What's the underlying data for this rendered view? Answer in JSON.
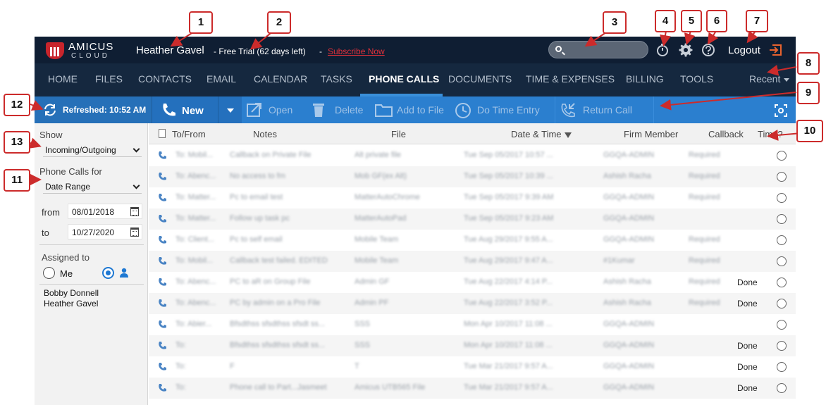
{
  "header": {
    "logo_text": "AMICUS",
    "logo_sub": "CLOUD",
    "user_name": "Heather Gavel",
    "trial_text": "- Free Trial (62 days left)",
    "trial_separator": "-",
    "subscribe_link": "Subscribe Now",
    "search_placeholder": "",
    "logout_label": "Logout"
  },
  "nav": {
    "items": [
      "HOME",
      "FILES",
      "CONTACTS",
      "EMAIL",
      "CALENDAR",
      "TASKS",
      "PHONE CALLS",
      "DOCUMENTS",
      "TIME & EXPENSES",
      "BILLING",
      "TOOLS"
    ],
    "active": "PHONE CALLS",
    "recent_label": "Recent"
  },
  "toolbar": {
    "refreshed_label": "Refreshed: 10:52 AM",
    "new_label": "New",
    "open_label": "Open",
    "delete_label": "Delete",
    "add_to_file_label": "Add to File",
    "do_time_entry_label": "Do Time Entry",
    "return_call_label": "Return Call"
  },
  "sidebar": {
    "show_label": "Show",
    "show_value": "Incoming/Outgoing",
    "phone_calls_for_label": "Phone Calls for",
    "phone_calls_for_value": "Date Range",
    "from_label": "from",
    "from_value": "08/01/2018",
    "to_label": "to",
    "to_value": "10/27/2020",
    "assigned_label": "Assigned to",
    "me_label": "Me",
    "assigned_people": [
      "Bobby Donnell",
      "Heather Gavel"
    ]
  },
  "grid": {
    "columns": {
      "to_from": "To/From",
      "notes": "Notes",
      "file": "File",
      "date_time": "Date & Time",
      "firm_member": "Firm Member",
      "callback": "Callback",
      "time": "Time?"
    },
    "sort_column": "Date & Time",
    "sort_direction": "descending",
    "rows": [
      {
        "to_from": "To: Mobil...",
        "notes": "Callback on Private File",
        "file": "Alt private file",
        "date": "Tue Sep 05/2017 10:57 ...",
        "member": "GGQA-ADMIN",
        "callback": "Required",
        "time": ""
      },
      {
        "to_from": "To: Abenc...",
        "notes": "No access to fm",
        "file": "Mob GF(ex Alt)",
        "date": "Tue Sep 05/2017 10:39 ...",
        "member": "Ashish Racha",
        "callback": "Required",
        "time": ""
      },
      {
        "to_from": "To: Matter...",
        "notes": "Pc to email test",
        "file": "MatterAutoChrome",
        "date": "Tue Sep 05/2017 9:39 AM",
        "member": "GGQA-ADMIN",
        "callback": "Required",
        "time": ""
      },
      {
        "to_from": "To: Matter...",
        "notes": "Follow up task pc",
        "file": "MatterAutoPad",
        "date": "Tue Sep 05/2017 9:23 AM",
        "member": "GGQA-ADMIN",
        "callback": "",
        "time": ""
      },
      {
        "to_from": "To: Client...",
        "notes": "Pc to self email",
        "file": "Mobile Team",
        "date": "Tue Aug 29/2017 9:55 A...",
        "member": "GGQA-ADMIN",
        "callback": "Required",
        "time": ""
      },
      {
        "to_from": "To: Mobil...",
        "notes": "Callback test failed. EDITED",
        "file": "Mobile Team",
        "date": "Tue Aug 29/2017 9:47 A...",
        "member": "#1Kumar",
        "callback": "Required",
        "time": ""
      },
      {
        "to_from": "To: Abenc...",
        "notes": "PC to aR on Group File",
        "file": "Admin GF",
        "date": "Tue Aug 22/2017 4:14 P...",
        "member": "Ashish Racha",
        "callback": "Required",
        "time": "Done"
      },
      {
        "to_from": "To: Abenc...",
        "notes": "PC by admin on a Pro File",
        "file": "Admin PF",
        "date": "Tue Aug 22/2017 3:52 P...",
        "member": "Ashish Racha",
        "callback": "Required",
        "time": "Done"
      },
      {
        "to_from": "To: Abier...",
        "notes": "Bfsdthss sfsdthss sfsdt ss...",
        "file": "SSS",
        "date": "Mon Apr 10/2017 11:08 ...",
        "member": "GGQA-ADMIN",
        "callback": "",
        "time": ""
      },
      {
        "to_from": "To:",
        "notes": "Bfsdthss sfsdthss sfsdt ss...",
        "file": "SSS",
        "date": "Mon Apr 10/2017 11:08 ...",
        "member": "GGQA-ADMIN",
        "callback": "",
        "time": "Done"
      },
      {
        "to_from": "To:",
        "notes": "F",
        "file": "T",
        "date": "Tue Mar 21/2017 9:57 A...",
        "member": "GGQA-ADMIN",
        "callback": "",
        "time": "Done"
      },
      {
        "to_from": "To:",
        "notes": "Phone call to Part...Jasmeet",
        "file": "Amicus UTB565 File",
        "date": "Tue Mar 21/2017 9:57 A...",
        "member": "GGQA-ADMIN",
        "callback": "",
        "time": "Done"
      }
    ]
  },
  "callouts": [
    "1",
    "2",
    "3",
    "4",
    "5",
    "6",
    "7",
    "8",
    "9",
    "10",
    "11",
    "12",
    "13"
  ],
  "colors": {
    "topbar": "#0f1e33",
    "navbar": "#15283f",
    "toolbar": "#2b7fcf",
    "accent": "#3a8fd9",
    "callout_border": "#cc2b2b",
    "subscribe": "#e0303a"
  },
  "icons": {
    "search": "search-icon",
    "timer": "timer-icon",
    "settings": "gear-icon",
    "help": "help-icon",
    "logout": "logout-icon",
    "refresh": "refresh-icon",
    "new": "phone-icon",
    "open": "open-icon",
    "delete": "trash-icon",
    "add_to_file": "folder-icon",
    "time_entry": "clock-icon",
    "return_call": "return-call-icon",
    "capture": "screen-capture-icon",
    "calendar": "calendar-icon",
    "person": "person-icon"
  }
}
